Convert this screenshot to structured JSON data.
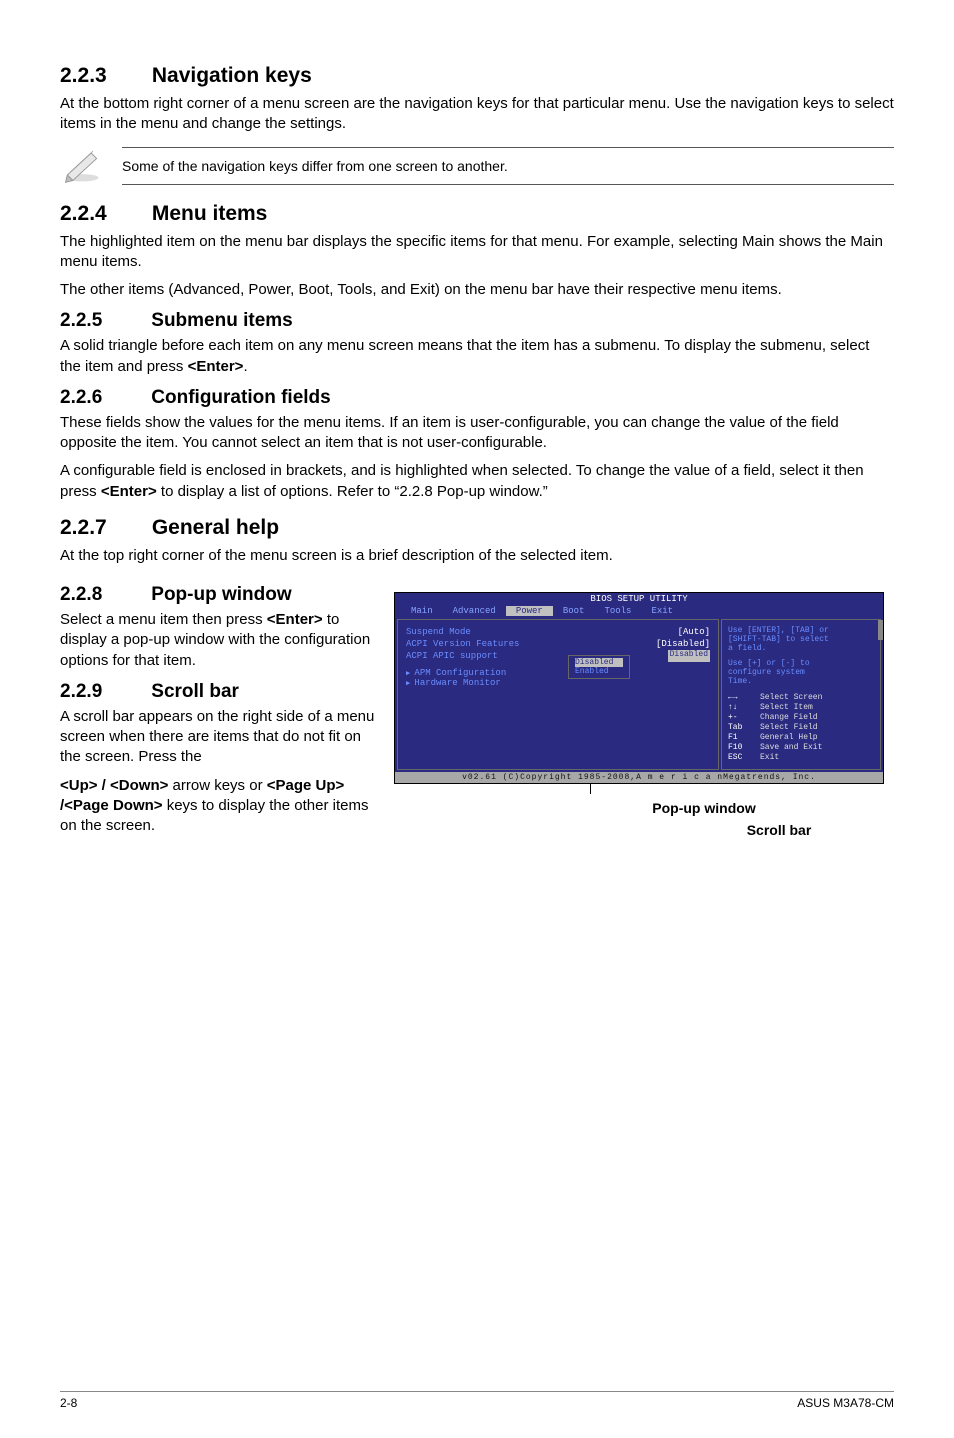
{
  "s223": {
    "num": "2.2.3",
    "title": "Navigation keys",
    "p1": "At the bottom right corner of a menu screen are the navigation keys for that particular menu. Use the navigation keys to select items in the menu and change the settings.",
    "note": "Some of the navigation keys differ from one screen to another."
  },
  "s224": {
    "num": "2.2.4",
    "title": "Menu items",
    "p1": "The highlighted item on the menu bar  displays the specific items for that menu. For example, selecting Main shows the Main menu items.",
    "p2": "The other items (Advanced, Power, Boot, Tools, and Exit) on the menu bar have their respective menu items."
  },
  "s225": {
    "num": "2.2.5",
    "title": "Submenu items",
    "p1_a": "A solid triangle before each item on any menu screen means that the item has a submenu. To display the submenu, select the item and press ",
    "p1_key": "<Enter>",
    "p1_b": "."
  },
  "s226": {
    "num": "2.2.6",
    "title": "Configuration fields",
    "p1": "These fields show the values for the menu items. If an item is user-configurable, you can change the value of the field opposite the item. You cannot select an item that is not user-configurable.",
    "p2_a": "A configurable field is enclosed in brackets, and is highlighted when selected. To change the value of a field, select it then press ",
    "p2_key": "<Enter>",
    "p2_b": " to display a list of options. Refer to “2.2.8 Pop-up window.”"
  },
  "s227": {
    "num": "2.2.7",
    "title": "General help",
    "p1": "At the top right corner of the menu screen is a brief description of the selected item."
  },
  "s228": {
    "num": "2.2.8",
    "title": "Pop-up window",
    "p1_a": "Select a menu item then press ",
    "p1_key": "<Enter>",
    "p1_b": " to display a pop-up window with the configuration options for that item."
  },
  "s229": {
    "num": "2.2.9",
    "title": "Scroll bar",
    "p1": "A scroll bar appears on the right side of a menu screen when there are items that do not fit on the screen. Press the",
    "p2_a": "<Up> / <Down>",
    "p2_b": " arrow keys or ",
    "p2_c": "<Page Up> /<Page Down>",
    "p2_d": " keys to display the other items on the screen."
  },
  "bios": {
    "title": "BIOS SETUP UTILITY",
    "tabs": [
      "Main",
      "Advanced",
      "Power",
      "Boot",
      "Tools",
      "Exit"
    ],
    "active_tab": "Power",
    "rows": [
      {
        "label": "Suspend Mode",
        "value": "[Auto]"
      },
      {
        "label": "ACPI Version Features",
        "value": "[Disabled]"
      },
      {
        "label": "ACPI APIC support",
        "value": "Disabled"
      }
    ],
    "subs": [
      "APM Configuration",
      "Hardware Monitor"
    ],
    "popup": {
      "opt1": "Disabled",
      "opt2": "Enabled"
    },
    "help": {
      "l1": "Use [ENTER], [TAB] or",
      "l2": "[SHIFT-TAB] to select",
      "l3": "a field.",
      "l4": "Use [+] or [-] to",
      "l5": "configure system",
      "l6": "Time."
    },
    "nav": [
      {
        "k": "←→",
        "t": "Select Screen"
      },
      {
        "k": "↑↓",
        "t": "Select Item"
      },
      {
        "k": "+-",
        "t": "Change Field"
      },
      {
        "k": "Tab",
        "t": "Select Field"
      },
      {
        "k": "F1",
        "t": "General Help"
      },
      {
        "k": "F10",
        "t": "Save and Exit"
      },
      {
        "k": "ESC",
        "t": "Exit"
      }
    ],
    "footer": "v02.61 (C)Copyright 1985-2008,A m e r i c a nMegatrends, Inc."
  },
  "captions": {
    "popup": "Pop-up window",
    "scroll": "Scroll bar"
  },
  "footer": {
    "left": "2-8",
    "right": "ASUS M3A78-CM"
  }
}
